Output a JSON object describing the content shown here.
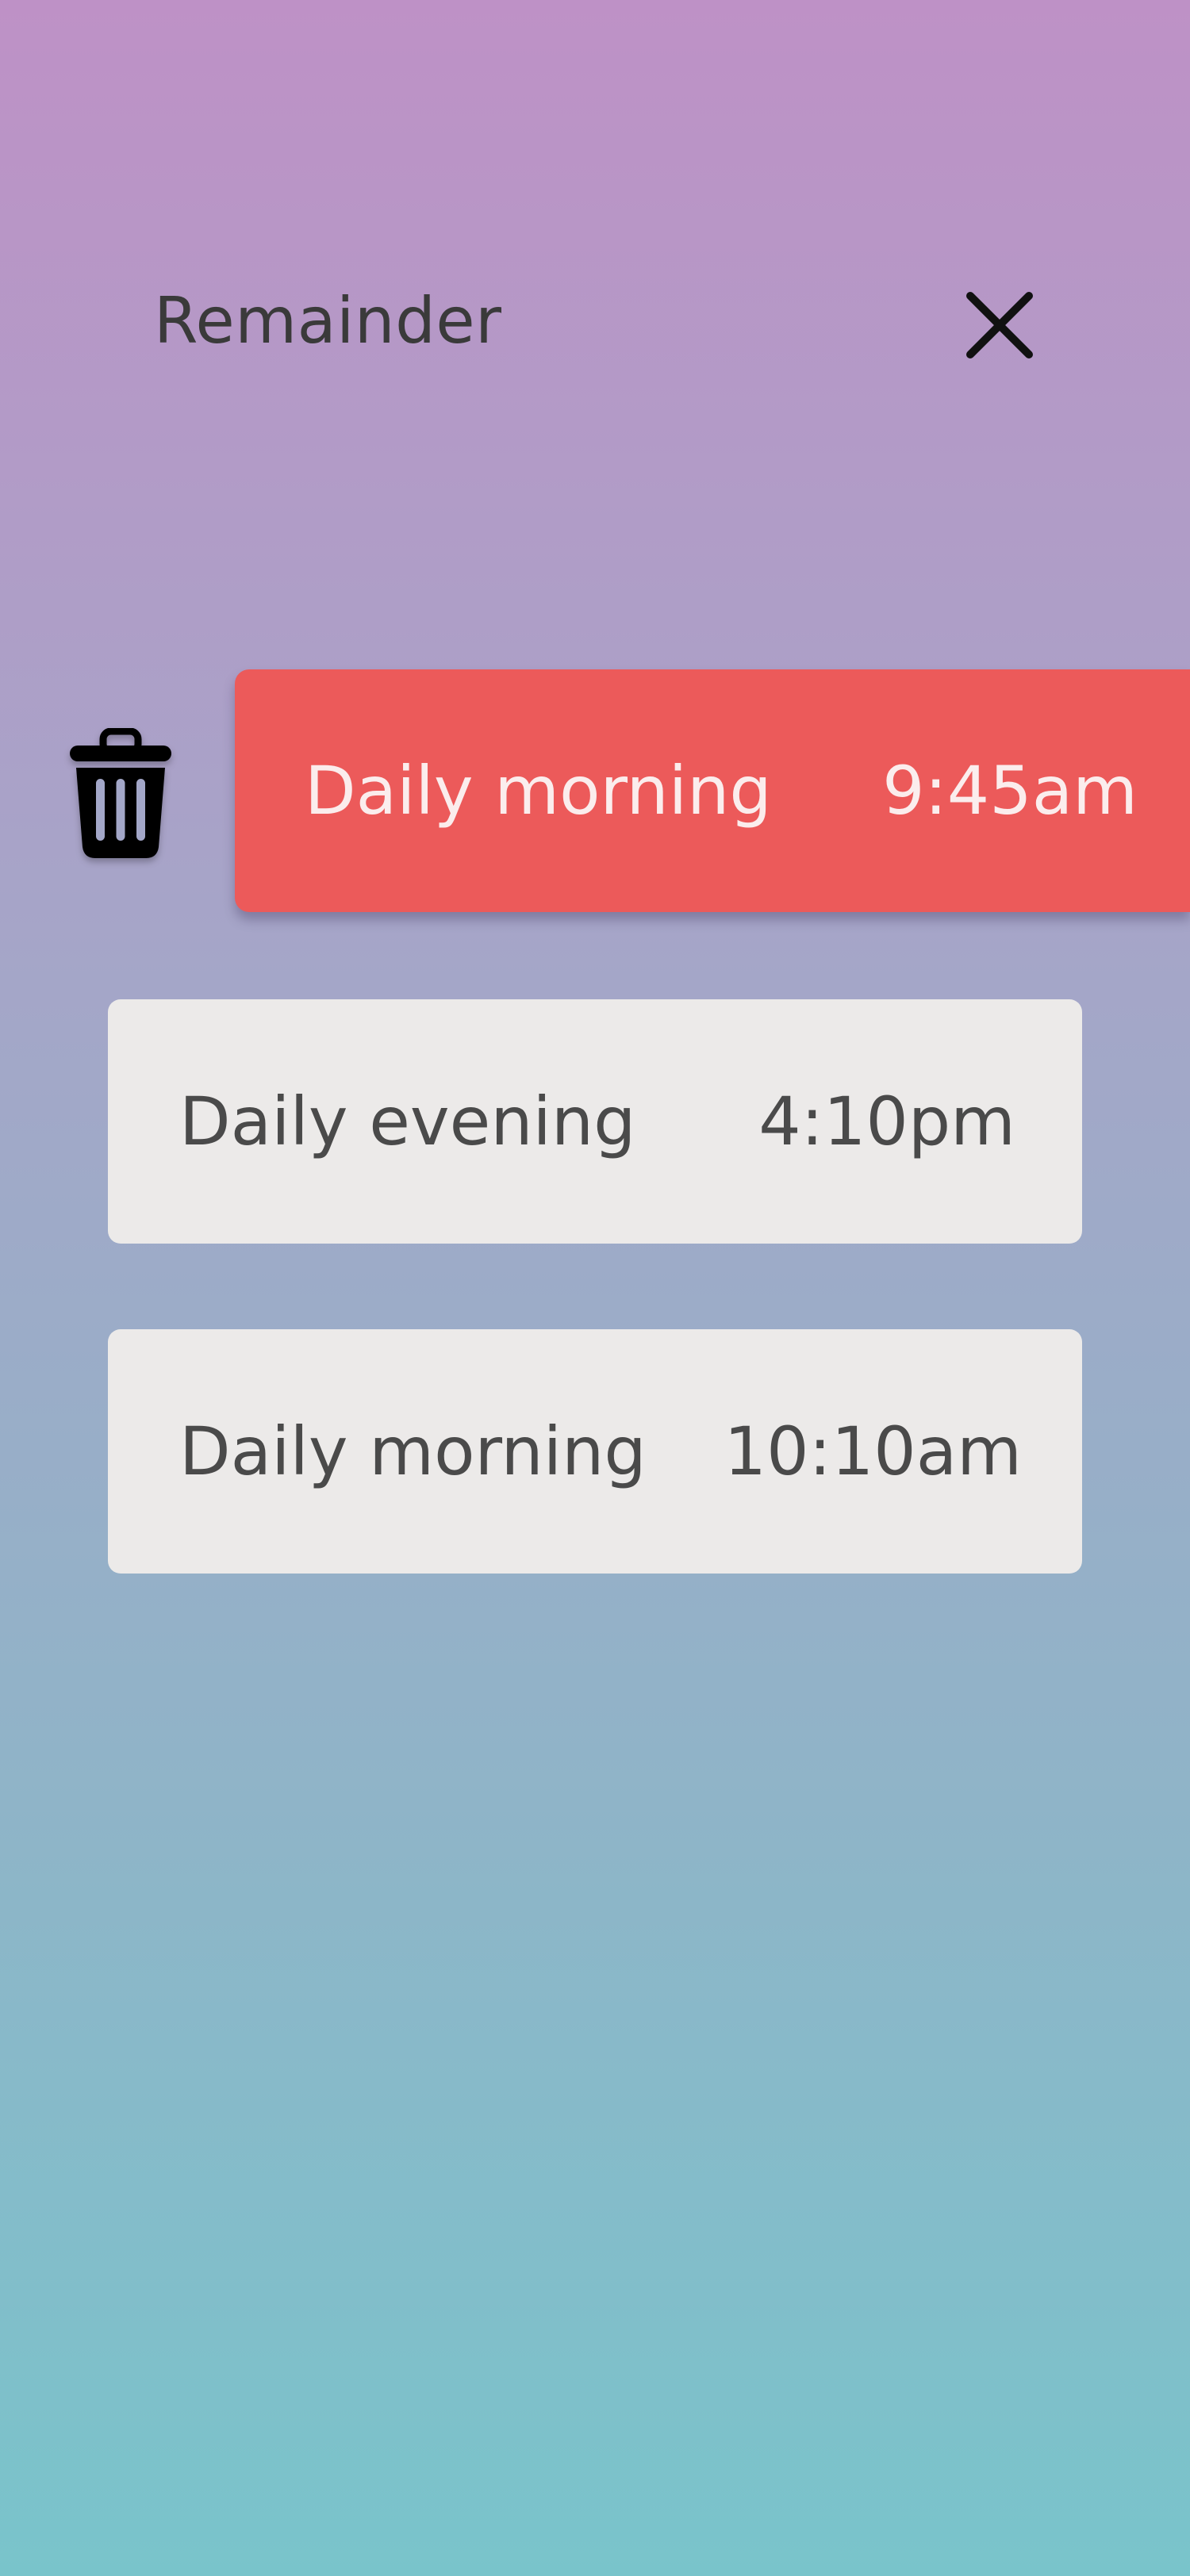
{
  "header": {
    "title": "Remainder"
  },
  "icons": {
    "close": "close-icon",
    "delete": "trash-icon"
  },
  "reminders": [
    {
      "label": "Daily morning",
      "time": "9:45am",
      "state": "swiped-for-delete"
    },
    {
      "label": "Daily evening",
      "time": "4:10pm",
      "state": "normal"
    },
    {
      "label": "Daily morning",
      "time": "10:10am",
      "state": "normal"
    }
  ],
  "colors": {
    "gradient_top": "#BE91C6",
    "gradient_bottom": "#79C4CB",
    "active_card": "#EC5A5A",
    "card": "#ECEAE9",
    "text_dark": "#4A4A4A",
    "title_text": "#3A3A3A"
  }
}
